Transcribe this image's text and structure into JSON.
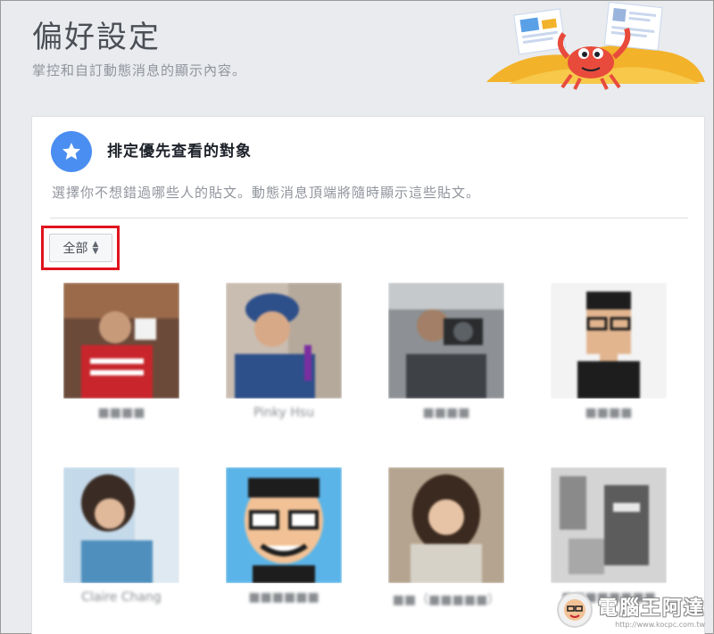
{
  "header": {
    "title": "偏好設定",
    "subtitle": "掌控和自訂動態消息的顯示內容。"
  },
  "section": {
    "title": "排定優先查看的對象",
    "description": "選擇你不想錯過哪些人的貼文。動態消息頂端將隨時顯示這些貼文。",
    "icon": "star-icon"
  },
  "filter": {
    "selected": "全部"
  },
  "friends": [
    {
      "name": "■■■■"
    },
    {
      "name": "Pinky Hsu"
    },
    {
      "name": "■■■■"
    },
    {
      "name": "■■■■"
    },
    {
      "name": "Claire Chang"
    },
    {
      "name": "■■■■■■"
    },
    {
      "name": "■■（■■■■■）"
    },
    {
      "name": "■■■■■■■■"
    }
  ],
  "watermark": {
    "main": "電腦王阿達",
    "url": "http://www.kocpc.com.tw"
  },
  "colors": {
    "accent": "#4b8ef1",
    "highlight": "#e0141e",
    "background": "#e9ebee"
  }
}
